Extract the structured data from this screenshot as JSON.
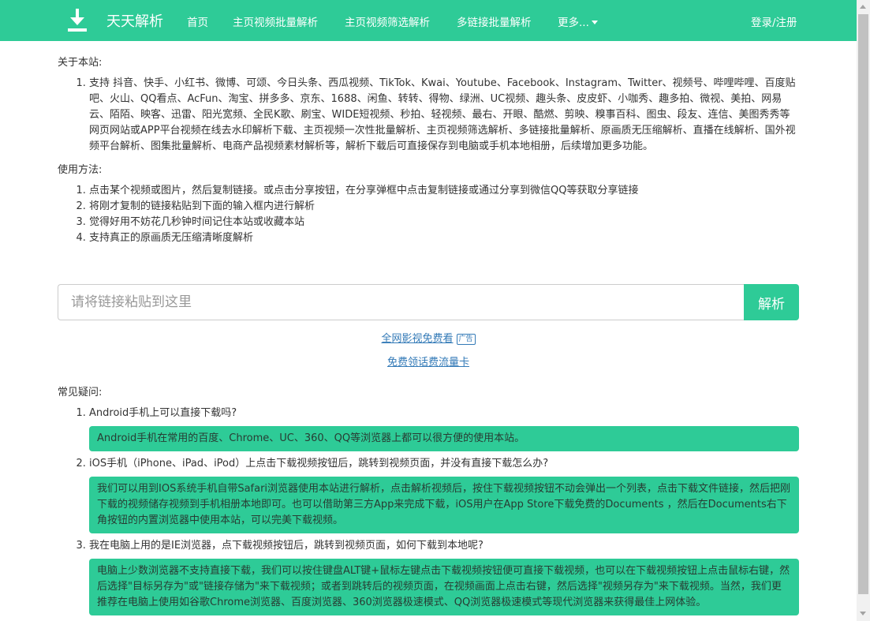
{
  "nav": {
    "brand": "天天解析",
    "links": [
      "首页",
      "主页视频批量解析",
      "主页视频筛选解析",
      "多链接批量解析",
      "更多..."
    ],
    "login": "登录/注册"
  },
  "about": {
    "title": "关于本站:",
    "items": [
      "支持 抖音、快手、小红书、微博、可颂、今日头条、西瓜视频、TikTok、Kwai、Youtube、Facebook、Instagram、Twitter、视频号、哔哩哔哩、百度贴吧、火山、QQ看点、AcFun、淘宝、拼多多、京东、1688、闲鱼、转转、得物、绿洲、UC视频、趣头条、皮皮虾、小咖秀、趣多拍、微视、美拍、网易云、陌陌、映客、迅雷、阳光宽频、全民K歌、刷宝、WIDE短视频、秒拍、轻视频、最右、开眼、酷燃、剪映、糗事百科、图虫、段友、连信、美图秀秀等网页网站或APP平台视频在线去水印解析下载、主页视频一次性批量解析、主页视频筛选解析、多链接批量解析、原画质无压缩解析、直播在线解析、国外视频平台解析、图集批量解析、电商产品视频素材解析等，解析下载后可直接保存到电脑或手机本地相册，后续增加更多功能。"
    ]
  },
  "usage": {
    "title": "使用方法:",
    "items": [
      "点击某个视频或图片，然后复制链接。或点击分享按钮，在分享弹框中点击复制链接或通过分享到微信QQ等获取分享链接",
      "将刚才复制的链接粘贴到下面的输入框内进行解析",
      "觉得好用不妨花几秒钟时间记住本站或收藏本站",
      "支持真正的原画质无压缩清晰度解析"
    ]
  },
  "search": {
    "placeholder": "请将链接粘贴到这里",
    "button": "解析"
  },
  "ad": {
    "text": "全网影视免费看",
    "badge": "广告"
  },
  "card_link": "免费领话费流量卡",
  "faq": {
    "title": "常见疑问:",
    "items": [
      {
        "q": "Android手机上可以直接下载吗?",
        "a": "Android手机在常用的百度、Chrome、UC、360、QQ等浏览器上都可以很方便的使用本站。"
      },
      {
        "q": "iOS手机（iPhone、iPad、iPod）上点击下载视频按钮后，跳转到视频页面，并没有直接下载怎么办?",
        "a": "我们可以用到IOS系统手机自带Safari浏览器使用本站进行解析，点击解析视频后，按住下载视频按钮不动会弹出一个列表，点击下载文件链接，然后把刚下载的视频储存视频到手机相册本地即可。也可以借助第三方App来完成下载，iOS用户在App Store下载免费的Documents ，然后在Documents右下角按钮的内置浏览器中使用本站，可以完美下载视频。"
      },
      {
        "q": "我在电脑上用的是IE浏览器，点下载视频按钮后，跳转到视频页面，如何下载到本地呢?",
        "a": "电脑上少数浏览器不支持直接下载，我们可以按住键盘ALT键+鼠标左键点击下载视频按钮便可直接下载视频，也可以在下载视频按钮上点击鼠标右键，然后选择\"目标另存为\"或\"链接存储为\"来下载视频；或者到跳转后的视频页面，在视频画面上点击右键，然后选择\"视频另存为\"来下载视频。当然，我们更推荐在电脑上使用如谷歌Chrome浏览器、百度浏览器、360浏览器极速模式、QQ浏览器极速模式等现代浏览器来获得最佳上网体验。"
      }
    ]
  },
  "colors": {
    "accent": "#2ecb97",
    "link": "#337ab7"
  },
  "icons": {
    "brand": "download-icon"
  }
}
